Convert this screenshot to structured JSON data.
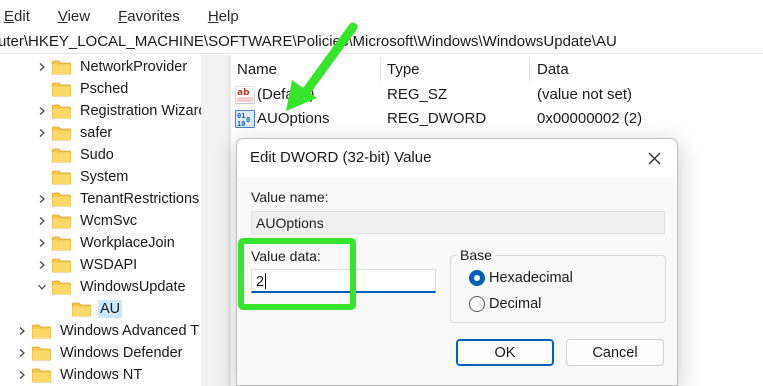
{
  "menu": [
    {
      "label": "Edit"
    },
    {
      "label": "View"
    },
    {
      "label": "Favorites"
    },
    {
      "label": "Help"
    }
  ],
  "address": {
    "path": "uter\\HKEY_LOCAL_MACHINE\\SOFTWARE\\Policies\\Microsoft\\Windows\\WindowsUpdate\\AU"
  },
  "tree": {
    "items": [
      {
        "label": "NetworkProvider"
      },
      {
        "label": "Psched"
      },
      {
        "label": "Registration Wizard"
      },
      {
        "label": "safer"
      },
      {
        "label": "Sudo"
      },
      {
        "label": "System"
      },
      {
        "label": "TenantRestrictions"
      },
      {
        "label": "WcmSvc"
      },
      {
        "label": "WorkplaceJoin"
      },
      {
        "label": "WSDAPI"
      },
      {
        "label": "WindowsUpdate"
      },
      {
        "label": "AU"
      },
      {
        "label": "Windows Advanced T"
      },
      {
        "label": "Windows Defender"
      },
      {
        "label": "Windows NT"
      }
    ]
  },
  "list": {
    "columns": {
      "name": "Name",
      "type": "Type",
      "data": "Data"
    },
    "rows": [
      {
        "name": "(Default)",
        "type": "REG_SZ",
        "data": "(value not set)",
        "icon": "string-value-icon"
      },
      {
        "name": "AUOptions",
        "type": "REG_DWORD",
        "data": "0x00000002 (2)",
        "icon": "dword-value-icon"
      }
    ]
  },
  "dialog": {
    "title": "Edit DWORD (32-bit) Value",
    "value_name_label": "Value name:",
    "value_name": "AUOptions",
    "value_data_label": "Value data:",
    "value_data": "2",
    "base_label": "Base",
    "base_options": [
      {
        "label": "Hexadecimal",
        "selected": true
      },
      {
        "label": "Decimal",
        "selected": false
      }
    ],
    "ok_label": "OK",
    "cancel_label": "Cancel"
  },
  "colors": {
    "accent": "#005fb8",
    "annotation": "#38e32d",
    "folder": "#f5c54a",
    "selection": "#cce8ff"
  }
}
